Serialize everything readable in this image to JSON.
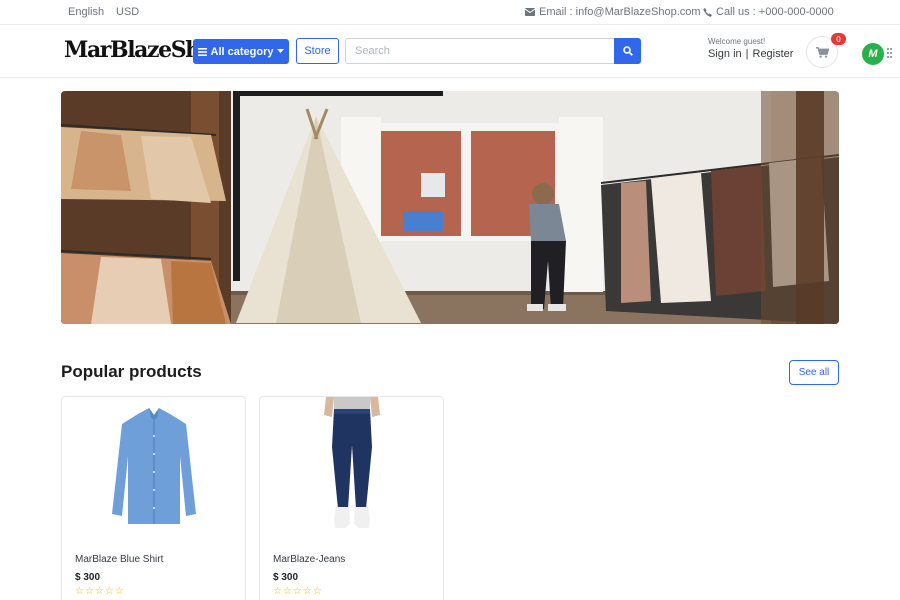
{
  "topbar": {
    "language": "English",
    "currency": "USD",
    "email": "Email : info@MarBlazeShop.com",
    "phone": "Call us : +000-000-0000"
  },
  "header": {
    "logo": "MarBlazeShop",
    "category_button": "All category",
    "store_button": "Store",
    "search_placeholder": "Search",
    "welcome": "Welcome guest!",
    "sign_in": "Sign in",
    "separator": "|",
    "register": "Register",
    "cart_count": "0",
    "extension_label": "M"
  },
  "hero": {
    "icon": "clothing-store-photo"
  },
  "popular": {
    "title": "Popular products",
    "see_all": "See all",
    "products": [
      {
        "name": "MarBlaze Blue Shirt",
        "price": "$ 300",
        "stars": "☆☆☆☆☆",
        "icon": "blue-shirt-image"
      },
      {
        "name": "MarBlaze-Jeans",
        "price": "$ 300",
        "stars": "☆☆☆☆☆",
        "icon": "jeans-image"
      }
    ]
  },
  "colors": {
    "primary": "#3167eb",
    "badge": "#e53935",
    "star": "#f4b400",
    "extension": "#26b24a"
  }
}
